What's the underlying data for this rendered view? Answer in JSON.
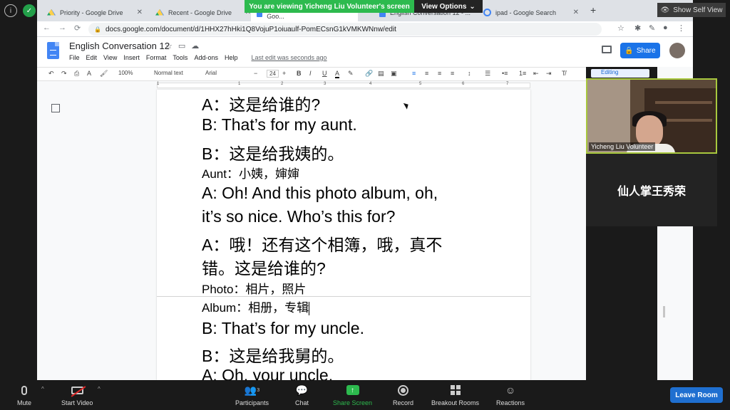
{
  "zoom": {
    "banner": "You are viewing Yicheng Liu Volunteer's screen",
    "view_options": "View Options",
    "show_self_view": "Show Self View",
    "participants_count": "3",
    "buttons": {
      "mute": "Mute",
      "start_video": "Start Video",
      "participants": "Participants",
      "chat": "Chat",
      "share_screen": "Share Screen",
      "record": "Record",
      "breakout_rooms": "Breakout Rooms",
      "reactions": "Reactions",
      "leave_room": "Leave Room"
    },
    "video_tile_name": "Yicheng Liu Volunteer",
    "name_tile": "仙人掌王秀荣",
    "colors": {
      "banner_green": "#2dba4e",
      "leave_blue": "#1f6fd0"
    }
  },
  "browser": {
    "tabs": [
      {
        "label": "Priority - Google Drive",
        "icon": "google-drive-icon"
      },
      {
        "label": "Recent - Google Drive",
        "icon": "google-drive-icon"
      },
      {
        "label": "English Conversation 12 - Goo...",
        "icon": "google-docs-icon"
      },
      {
        "label": "English Conversation 12 - ...",
        "icon": "google-docs-icon"
      },
      {
        "label": "ipad - Google Search",
        "icon": "google-icon"
      }
    ],
    "url": "docs.google.com/document/d/1HHX27hHki1Q8VojuP1oiuaulf-PomECsnG1kVMKWNnw/edit"
  },
  "docs": {
    "title": "English Conversation 12",
    "menu": [
      "File",
      "Edit",
      "View",
      "Insert",
      "Format",
      "Tools",
      "Add-ons",
      "Help"
    ],
    "last_edit": "Last edit was seconds ago",
    "share_label": "Share",
    "toolbar": {
      "zoom": "100%",
      "style": "Normal text",
      "font": "Arial",
      "font_size": "24",
      "mode": "Editing"
    },
    "ruler_numbers": [
      "1",
      "1",
      "2",
      "3",
      "4",
      "5",
      "6",
      "7"
    ],
    "lines": [
      {
        "text": "A：这是给谁的?",
        "size": "big"
      },
      {
        "text": "B: That’s for my aunt.",
        "size": "big"
      },
      {
        "text": "B：这是给我姨的。",
        "size": "big"
      },
      {
        "text": "Aunt：小姨，婶婶",
        "size": "small"
      },
      {
        "text": "A: Oh! And this photo album, oh,",
        "size": "big"
      },
      {
        "text": "it’s so nice. Who’s this for?",
        "size": "big"
      },
      {
        "text": "A：哦！还有这个相簿，哦，真不",
        "size": "big"
      },
      {
        "text": "错。这是给谁的?",
        "size": "big"
      },
      {
        "text": "Photo：相片，照片",
        "size": "small"
      },
      {
        "text": "Album：相册，专辑",
        "size": "small"
      },
      {
        "text": "B: That’s for my uncle.",
        "size": "big"
      },
      {
        "text": "B：这是给我舅的。",
        "size": "big"
      },
      {
        "text": "A: Oh, your uncle.",
        "size": "big"
      }
    ]
  }
}
